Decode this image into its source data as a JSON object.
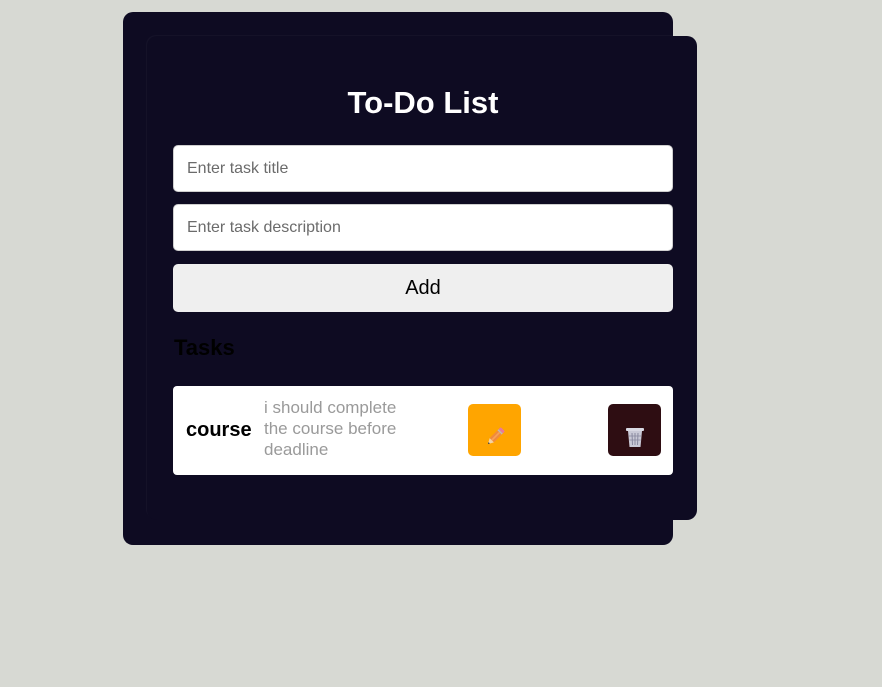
{
  "app": {
    "title": "To-Do List"
  },
  "form": {
    "title_placeholder": "Enter task title",
    "title_value": "",
    "description_placeholder": "Enter task description",
    "description_value": "",
    "add_label": "Add"
  },
  "tasks_section": {
    "heading": "Tasks",
    "items": [
      {
        "title": "course",
        "description": "i should complete the course before deadline",
        "edit_icon": "pencil-icon",
        "delete_icon": "trash-icon"
      }
    ]
  },
  "colors": {
    "page_background": "#d7d9d3",
    "card_background": "#0e0b22",
    "edit_button": "#ffa500",
    "delete_button": "#2e0d12"
  }
}
